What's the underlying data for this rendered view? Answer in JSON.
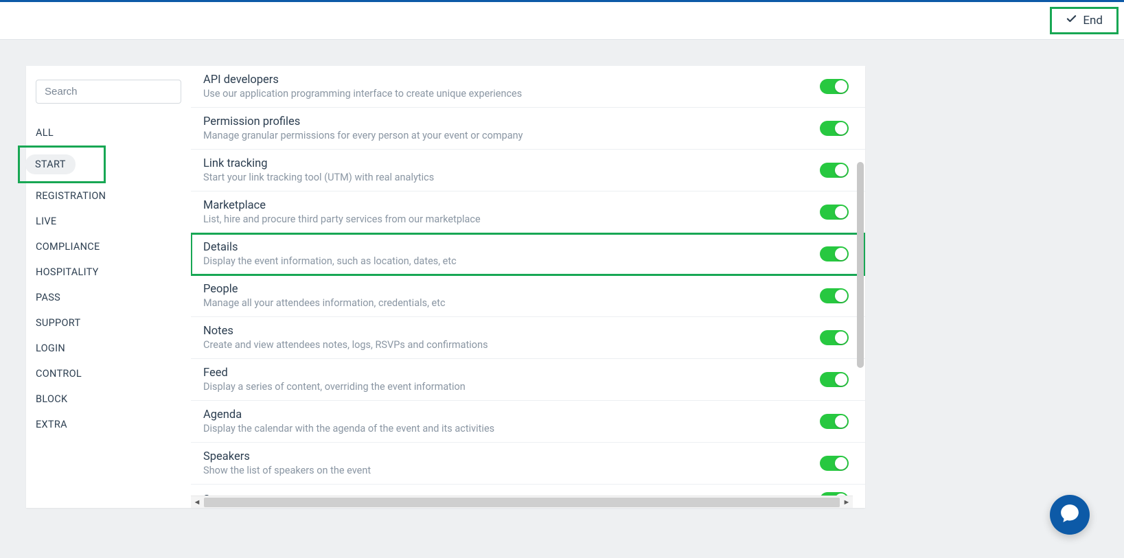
{
  "header": {
    "end_label": "End"
  },
  "sidebar": {
    "search_placeholder": "Search",
    "items": [
      {
        "label": "ALL",
        "active": false
      },
      {
        "label": "START",
        "active": true
      },
      {
        "label": "REGISTRATION",
        "active": false
      },
      {
        "label": "LIVE",
        "active": false
      },
      {
        "label": "COMPLIANCE",
        "active": false
      },
      {
        "label": "HOSPITALITY",
        "active": false
      },
      {
        "label": "PASS",
        "active": false
      },
      {
        "label": "SUPPORT",
        "active": false
      },
      {
        "label": "LOGIN",
        "active": false
      },
      {
        "label": "CONTROL",
        "active": false
      },
      {
        "label": "BLOCK",
        "active": false
      },
      {
        "label": "EXTRA",
        "active": false
      }
    ]
  },
  "features": [
    {
      "title": "API developers",
      "desc": "Use our application programming interface to create unique experiences",
      "on": true,
      "highlight": false
    },
    {
      "title": "Permission profiles",
      "desc": "Manage granular permissions for every person at your event or company",
      "on": true,
      "highlight": false
    },
    {
      "title": "Link tracking",
      "desc": "Start your link tracking tool (UTM) with real analytics",
      "on": true,
      "highlight": false
    },
    {
      "title": "Marketplace",
      "desc": "List, hire and procure third party services from our marketplace",
      "on": true,
      "highlight": false
    },
    {
      "title": "Details",
      "desc": "Display the event information, such as location, dates, etc",
      "on": true,
      "highlight": true
    },
    {
      "title": "People",
      "desc": "Manage all your attendees information, credentials, etc",
      "on": true,
      "highlight": false
    },
    {
      "title": "Notes",
      "desc": "Create and view attendees notes, logs, RSVPs and confirmations",
      "on": true,
      "highlight": false
    },
    {
      "title": "Feed",
      "desc": "Display a series of content, overriding the event information",
      "on": true,
      "highlight": false
    },
    {
      "title": "Agenda",
      "desc": "Display the calendar with the agenda of the event and its activities",
      "on": true,
      "highlight": false
    },
    {
      "title": "Speakers",
      "desc": "Show the list of speakers on the event",
      "on": true,
      "highlight": false
    },
    {
      "title": "Sponsors",
      "desc": "",
      "on": true,
      "highlight": false
    }
  ]
}
